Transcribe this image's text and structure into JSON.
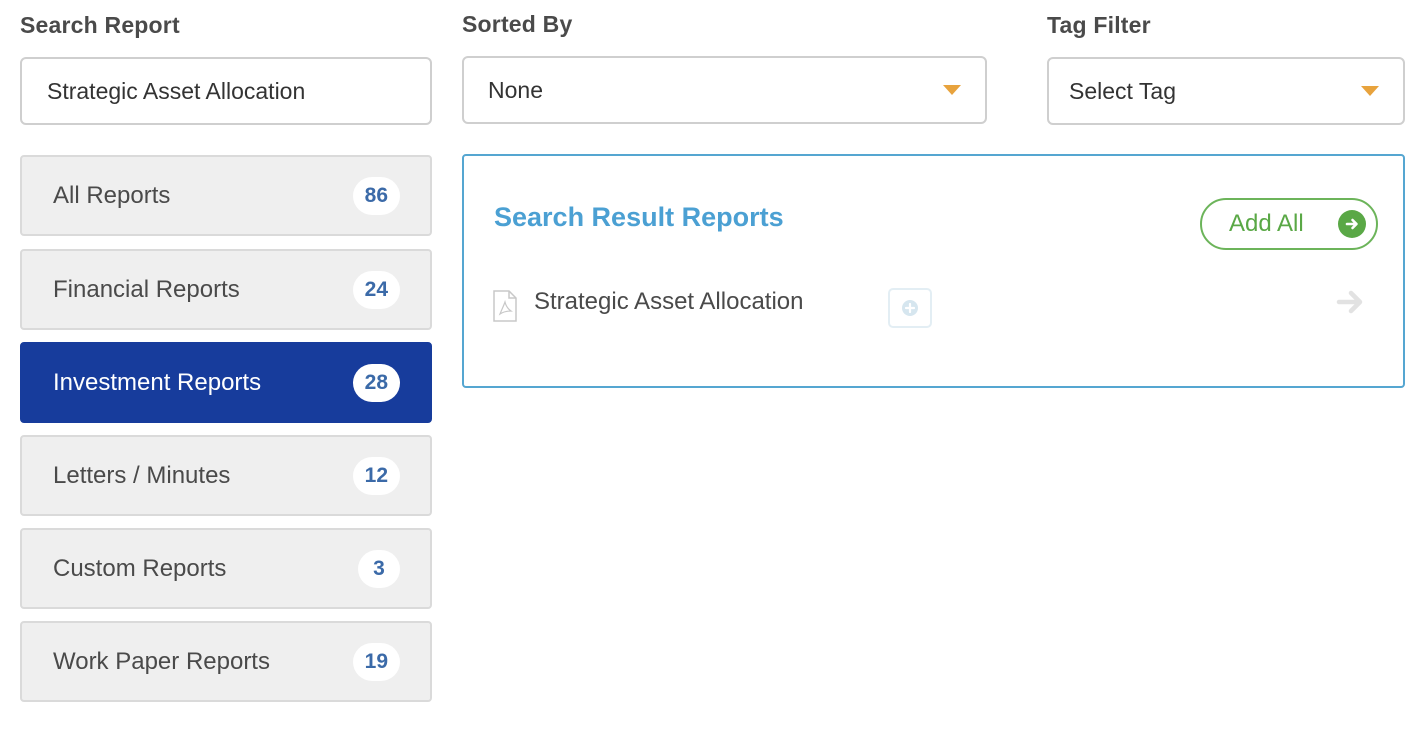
{
  "search": {
    "label": "Search Report",
    "value": "Strategic Asset Allocation"
  },
  "sort": {
    "label": "Sorted By",
    "selected": "None"
  },
  "tag_filter": {
    "label": "Tag Filter",
    "selected": "Select Tag"
  },
  "categories": [
    {
      "label": "All Reports",
      "count": "86"
    },
    {
      "label": "Financial Reports",
      "count": "24"
    },
    {
      "label": "Investment Reports",
      "count": "28",
      "active": true
    },
    {
      "label": "Letters / Minutes",
      "count": "12"
    },
    {
      "label": "Custom Reports",
      "count": "3"
    },
    {
      "label": "Work Paper Reports",
      "count": "19"
    }
  ],
  "results": {
    "title": "Search Result Reports",
    "add_all_label": "Add All",
    "items": [
      {
        "name": "Strategic Asset Allocation",
        "icon": "pdf-file-icon"
      }
    ]
  },
  "colors": {
    "accent_blue": "#173c9c",
    "title_blue": "#4ba0d3",
    "green": "#5aa846",
    "caret_orange": "#e8a33d"
  }
}
